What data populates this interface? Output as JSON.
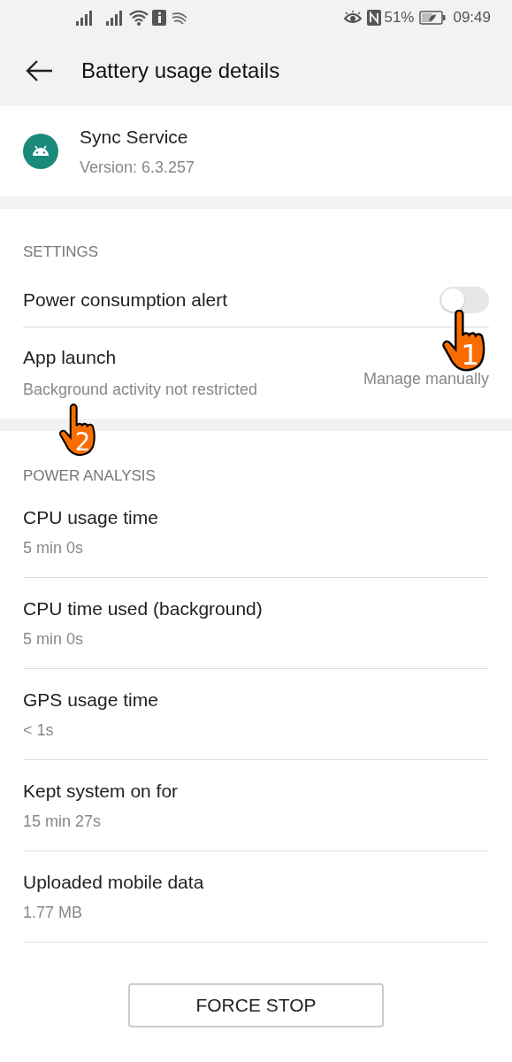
{
  "status_bar": {
    "battery_percent": "51%",
    "time": "09:49"
  },
  "toolbar": {
    "title": "Battery usage details"
  },
  "app": {
    "name": "Sync Service",
    "version": "Version: 6.3.257"
  },
  "settings": {
    "header": "SETTINGS",
    "items": [
      {
        "kind": "switch",
        "title": "Power consumption alert",
        "on": false,
        "step": "1"
      },
      {
        "kind": "link",
        "title": "App launch",
        "subtitle": "Background activity not restricted",
        "value": "Manage manually",
        "step": "2"
      }
    ]
  },
  "power_analysis": {
    "header": "POWER ANALYSIS",
    "items": [
      {
        "title": "CPU usage time",
        "value": "5 min 0s"
      },
      {
        "title": "CPU time used (background)",
        "value": "5 min 0s"
      },
      {
        "title": "GPS usage time",
        "value": "< 1s"
      },
      {
        "title": "Kept system on for",
        "value": "15 min 27s"
      },
      {
        "title": "Uploaded mobile data",
        "value": "1.77 MB"
      }
    ]
  },
  "force_stop_button": "FORCE STOP"
}
